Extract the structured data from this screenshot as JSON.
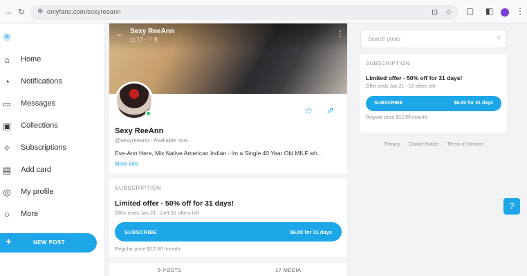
{
  "browser": {
    "url": "onlyfans.com/soxyreeann",
    "back_icon": "back-arrow-icon",
    "reload_icon": "reload-icon"
  },
  "sidebar": {
    "items": [
      {
        "label": "Home",
        "icon": "home-icon",
        "glyph": "⌂"
      },
      {
        "label": "Notifications",
        "icon": "bell-icon",
        "glyph": "◔"
      },
      {
        "label": "Messages",
        "icon": "message-icon",
        "glyph": "▭"
      },
      {
        "label": "Collections",
        "icon": "bookmark-icon",
        "glyph": "▣"
      },
      {
        "label": "Subscriptions",
        "icon": "star-user-icon",
        "glyph": "✧"
      },
      {
        "label": "Add card",
        "icon": "card-icon",
        "glyph": "▤"
      },
      {
        "label": "My profile",
        "icon": "profile-icon",
        "glyph": "◎"
      },
      {
        "label": "More",
        "icon": "more-icon",
        "glyph": "○"
      }
    ],
    "new_post_label": "NEW POST"
  },
  "profile": {
    "cover_name": "Sexy ReeAnn",
    "cover_stats": "▢ 17 · ♡ 8",
    "name": "Sexy ReeAnn",
    "handle": "@sexyreeann · Available now",
    "bio": "Eve-Ann Here, Mix Native American Indian · Im a Single 40 Year Old MILF wh...",
    "more_info": "More info",
    "subscription_head": "SUBSCRIPTION",
    "offer": "Limited offer - 50% off for 31 days!",
    "offer_sub": "Offer ends Jan 21 · Left 31 offers left",
    "subscribe_label": "SUBSCRIBE",
    "subscribe_price": "$6.00 for 31 days",
    "regular_price": "Regular price $12.00 /month",
    "tabs": [
      "5 POSTS",
      "17 MEDIA"
    ]
  },
  "right_panel": {
    "search_placeholder": "Search posts",
    "subscription_head": "SUBSCRIPTION",
    "offer": "Limited offer - 50% off for 31 days!",
    "offer_sub": "Offer ends Jan 21 · 12 offers left",
    "subscribe_label": "SUBSCRIBE",
    "subscribe_price": "$6.00 for 31 days",
    "regular_price": "Regular price $12.00 /month",
    "footer": [
      "Privacy",
      "Cookie Notice",
      "Terms of Service"
    ]
  },
  "colors": {
    "accent": "#1ea7e8",
    "online": "#26c26a"
  }
}
